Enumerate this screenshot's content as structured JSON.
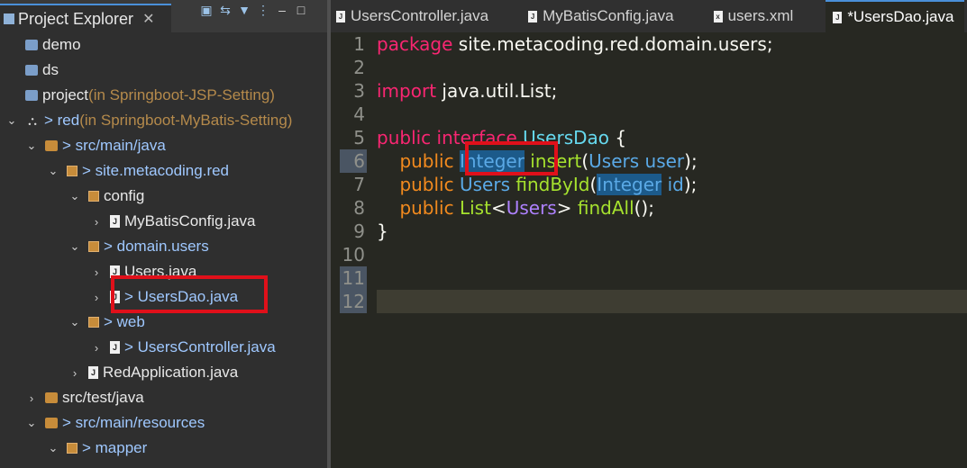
{
  "explorer": {
    "title": "Project Explorer",
    "close": "✕",
    "tools": [
      "collapse-all-icon",
      "link-editor-icon",
      "filter-icon",
      "view-menu-icon",
      "minimize-icon",
      "maximize-icon"
    ],
    "items": [
      {
        "label": "demo",
        "suffix": "",
        "depth": 0,
        "arrow": "",
        "icon": "folder"
      },
      {
        "label": "ds",
        "suffix": "",
        "depth": 0,
        "arrow": "",
        "icon": "folder"
      },
      {
        "label": "project",
        "suffix": " (in Springboot-JSP-Setting)",
        "depth": 0,
        "arrow": "",
        "icon": "folder"
      },
      {
        "label": "> red",
        "suffix": " (in Springboot-MyBatis-Setting)",
        "depth": 0,
        "arrow": "v",
        "icon": "project"
      },
      {
        "label": "> src/main/java",
        "suffix": "",
        "depth": 1,
        "arrow": "v",
        "icon": "srcfolder"
      },
      {
        "label": "> site.metacoding.red",
        "suffix": "",
        "depth": 2,
        "arrow": "v",
        "icon": "pkg"
      },
      {
        "label": "config",
        "suffix": "",
        "depth": 3,
        "arrow": "v",
        "icon": "pkg"
      },
      {
        "label": "MyBatisConfig.java",
        "suffix": "",
        "depth": 4,
        "arrow": ">",
        "icon": "java"
      },
      {
        "label": "> domain.users",
        "suffix": "",
        "depth": 3,
        "arrow": "v",
        "icon": "pkg"
      },
      {
        "label": "Users.java",
        "suffix": "",
        "depth": 4,
        "arrow": ">",
        "icon": "java"
      },
      {
        "label": "> UsersDao.java",
        "suffix": "",
        "depth": 4,
        "arrow": ">",
        "icon": "java"
      },
      {
        "label": "> web",
        "suffix": "",
        "depth": 3,
        "arrow": "v",
        "icon": "pkg"
      },
      {
        "label": "> UsersController.java",
        "suffix": "",
        "depth": 4,
        "arrow": ">",
        "icon": "java"
      },
      {
        "label": "RedApplication.java",
        "suffix": "",
        "depth": 3,
        "arrow": ">",
        "icon": "java"
      },
      {
        "label": "src/test/java",
        "suffix": "",
        "depth": 1,
        "arrow": ">",
        "icon": "srcfolder"
      },
      {
        "label": "> src/main/resources",
        "suffix": "",
        "depth": 1,
        "arrow": "v",
        "icon": "srcfolder"
      },
      {
        "label": "> mapper",
        "suffix": "",
        "depth": 2,
        "arrow": "v",
        "icon": "pkg"
      }
    ]
  },
  "editor": {
    "tabs": [
      {
        "label": "UsersController.java",
        "active": false,
        "icon": "J"
      },
      {
        "label": "MyBatisConfig.java",
        "active": false,
        "icon": "J"
      },
      {
        "label": "users.xml",
        "active": false,
        "icon": "x"
      },
      {
        "label": "*UsersDao.java",
        "active": true,
        "icon": "J"
      }
    ],
    "line_numbers": [
      "1",
      "2",
      "3",
      "4",
      "5",
      "6",
      "7",
      "8",
      "9",
      "10",
      "11",
      "12"
    ],
    "code": {
      "l1_kw": "package",
      "l1_rest": " site.metacoding.red.domain.users;",
      "l3_kw": "import",
      "l3_rest": " java.util.List;",
      "l5_kw1": "public",
      "l5_kw2": " interface",
      "l5_name": " UsersDao",
      "l5_brace": " {",
      "l6_indent": "    ",
      "l6_kw": "public",
      "l6_type": "Integer",
      "l6_fn": " insert",
      "l6_p1": "(",
      "l6_ptype": "Users",
      "l6_pname": " user",
      "l6_end": ");",
      "l7_kw": "public",
      "l7_type": " Users",
      "l7_fn": " findById",
      "l7_p1": "(",
      "l7_ptype": "Integer",
      "l7_pname": " id",
      "l7_end": ");",
      "l8_kw": "public",
      "l8_type": " List",
      "l8_lt": "<",
      "l8_gen": "Users",
      "l8_gt": ">",
      "l8_fn": " findAll",
      "l8_end": "();",
      "l9": "}"
    }
  }
}
